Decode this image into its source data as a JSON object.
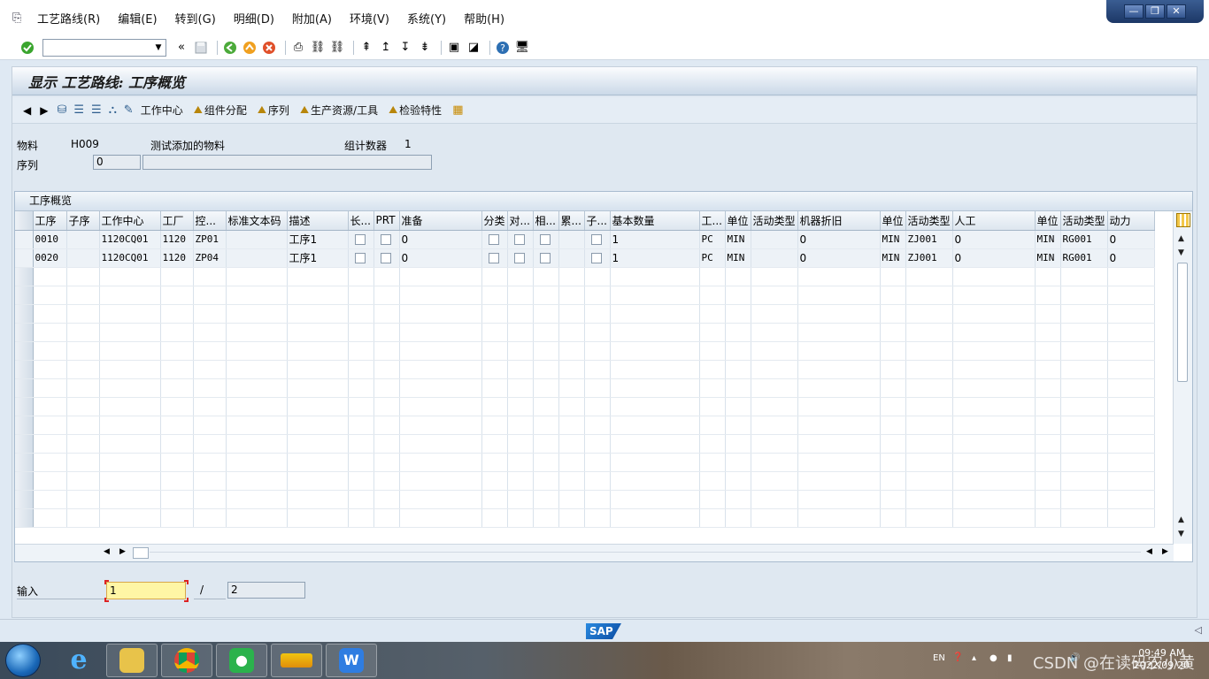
{
  "menu": [
    "工艺路线(R)",
    "编辑(E)",
    "转到(G)",
    "明细(D)",
    "附加(A)",
    "环境(V)",
    "系统(Y)",
    "帮助(H)"
  ],
  "window_buttons": {
    "minimize": "—",
    "restore": "❐",
    "close": "✕"
  },
  "command_field": {
    "value": ""
  },
  "title": "显示 工艺路线: 工序概览",
  "app_toolbar": {
    "work_center": "工作中心",
    "component_alloc": "组件分配",
    "sequence": "序列",
    "prt": "生产资源/工具",
    "inspection": "检验特性"
  },
  "header": {
    "material_label": "物料",
    "material_value": "H009",
    "material_desc": "测试添加的物料",
    "group_counter_label": "组计数器",
    "group_counter_value": "1",
    "sequence_label": "序列",
    "sequence_value": "0",
    "sequence_desc": ""
  },
  "table": {
    "title": "工序概览",
    "columns": [
      "工序",
      "子序",
      "工作中心",
      "工厂",
      "控...",
      "标准文本码",
      "描述",
      "长...",
      "PRT",
      "准备",
      "分类",
      "对...",
      "相...",
      "累...",
      "子...",
      "基本数量",
      "工...",
      "单位",
      "活动类型",
      "机器折旧",
      "单位",
      "活动类型",
      "人工",
      "单位",
      "活动类型",
      "动力"
    ],
    "rows": [
      [
        "0010",
        "",
        "1120CQ01",
        "1120",
        "ZP01",
        "",
        "工序1",
        "",
        "",
        "0",
        "",
        "",
        "",
        "",
        "",
        "1",
        "PC",
        "MIN",
        "",
        "0",
        "MIN",
        "ZJ001",
        "0",
        "MIN",
        "RG001",
        "0"
      ],
      [
        "0020",
        "",
        "1120CQ01",
        "1120",
        "ZP04",
        "",
        "工序1",
        "",
        "",
        "0",
        "",
        "",
        "",
        "",
        "",
        "1",
        "PC",
        "MIN",
        "",
        "0",
        "MIN",
        "ZJ001",
        "0",
        "MIN",
        "RG001",
        "0"
      ]
    ]
  },
  "entry": {
    "label": "输入",
    "value": "1",
    "separator": "/",
    "total": "2"
  },
  "status": {
    "logo": "SAP"
  },
  "taskbar": {
    "tray_lang": "EN",
    "time": "09:49 AM",
    "date": "2022/09/20",
    "watermark": "CSDN @在读码农小黄"
  }
}
